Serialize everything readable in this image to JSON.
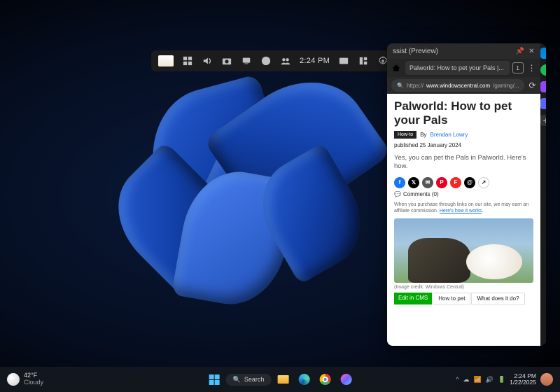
{
  "topbar": {
    "time": "2:24 PM"
  },
  "panel": {
    "title": "ssist (Preview)",
    "tab": "Palworld: How to pet your Pals |...",
    "tab_count": "1",
    "url_domain": "www.windowscentral.com",
    "url_path": "/gaming/..."
  },
  "article": {
    "headline": "Palworld: How to pet your Pals",
    "tag": "How-to",
    "by": "By",
    "author": "Brendan Lowry",
    "pub": "published 25 January 2024",
    "lead": "Yes, you can pet the Pals in Palworld. Here's how.",
    "comments": "Comments (0)",
    "affiliate1": "When you purchase through links on our site, we may earn an affiliate commission.",
    "affiliate_link": "Here's how it works",
    "credit": "(Image credit: Windows Central)",
    "cms": "Edit in CMS",
    "nav1": "How to pet",
    "nav2": "What does it do?"
  },
  "taskbar": {
    "temp": "42°F",
    "cond": "Cloudy",
    "search": "Search",
    "time": "2:24 PM",
    "date": "1/22/2025"
  }
}
